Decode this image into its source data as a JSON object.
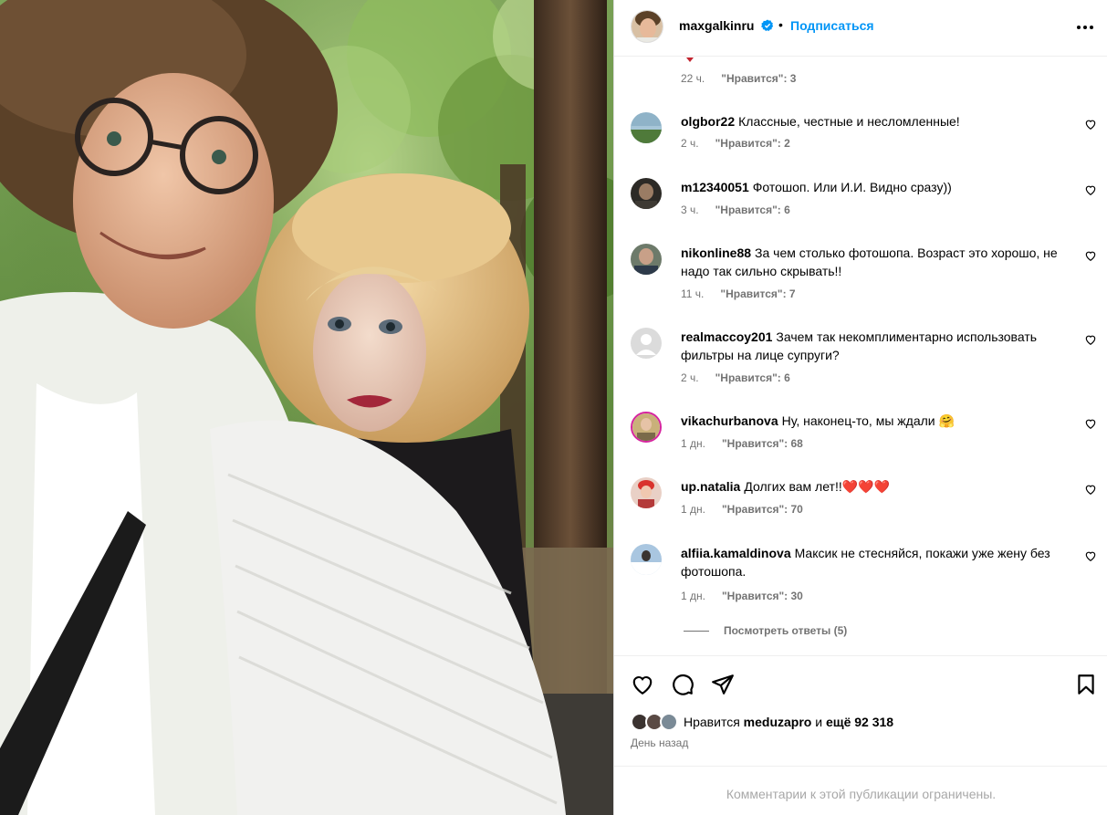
{
  "post": {
    "username": "maxgalkinru",
    "dot": "•",
    "follow_label": "Подписаться"
  },
  "top_partial_comment": {
    "time": "22 ч.",
    "likes": "\"Нравится\": 3"
  },
  "comments": [
    {
      "username": "olgbor22",
      "text": "Классные, честные и несломленные!",
      "time": "2 ч.",
      "likes": "\"Нравится\": 2"
    },
    {
      "username": "m12340051",
      "text": "Фотошоп. Или И.И. Видно сразу))",
      "time": "3 ч.",
      "likes": "\"Нравится\": 6"
    },
    {
      "username": "nikonline88",
      "text": "За чем столько фотошопа. Возраст это хорошо, не надо так сильно скрывать!!",
      "time": "11 ч.",
      "likes": "\"Нравится\": 7"
    },
    {
      "username": "realmaccoy201",
      "text": "Зачем так некомплиментарно использовать фильтры на лице супруги?",
      "time": "2 ч.",
      "likes": "\"Нравится\": 6"
    },
    {
      "username": "vikachurbanova",
      "text": "Ну, наконец-то, мы ждали 🤗",
      "time": "1 дн.",
      "likes": "\"Нравится\": 68"
    },
    {
      "username": "up.natalia",
      "text": "Долгих вам лет!!❤️❤️❤️",
      "time": "1 дн.",
      "likes": "\"Нравится\": 70"
    },
    {
      "username": "alfiia.kamaldinova",
      "text": "Максик не стесняйся, покажи уже жену без фотошопа.",
      "time": "1 дн.",
      "likes": "\"Нравится\": 30"
    }
  ],
  "view_replies_label": "Посмотреть ответы (5)",
  "likes_summary": {
    "prefix": "Нравится",
    "user": "meduzapro",
    "middle": "и",
    "rest": "ещё 92 318"
  },
  "posted_date": "День назад",
  "comments_restricted": "Комментарии к этой публикации ограничены.",
  "colors": {
    "link_blue": "#0095f6",
    "meta_gray": "#737373",
    "divider": "#efefef",
    "restricted_gray": "#a8a8a8"
  },
  "icons": [
    "verified-badge-icon",
    "more-options-icon",
    "heart-icon",
    "comment-icon",
    "share-icon",
    "bookmark-icon"
  ]
}
